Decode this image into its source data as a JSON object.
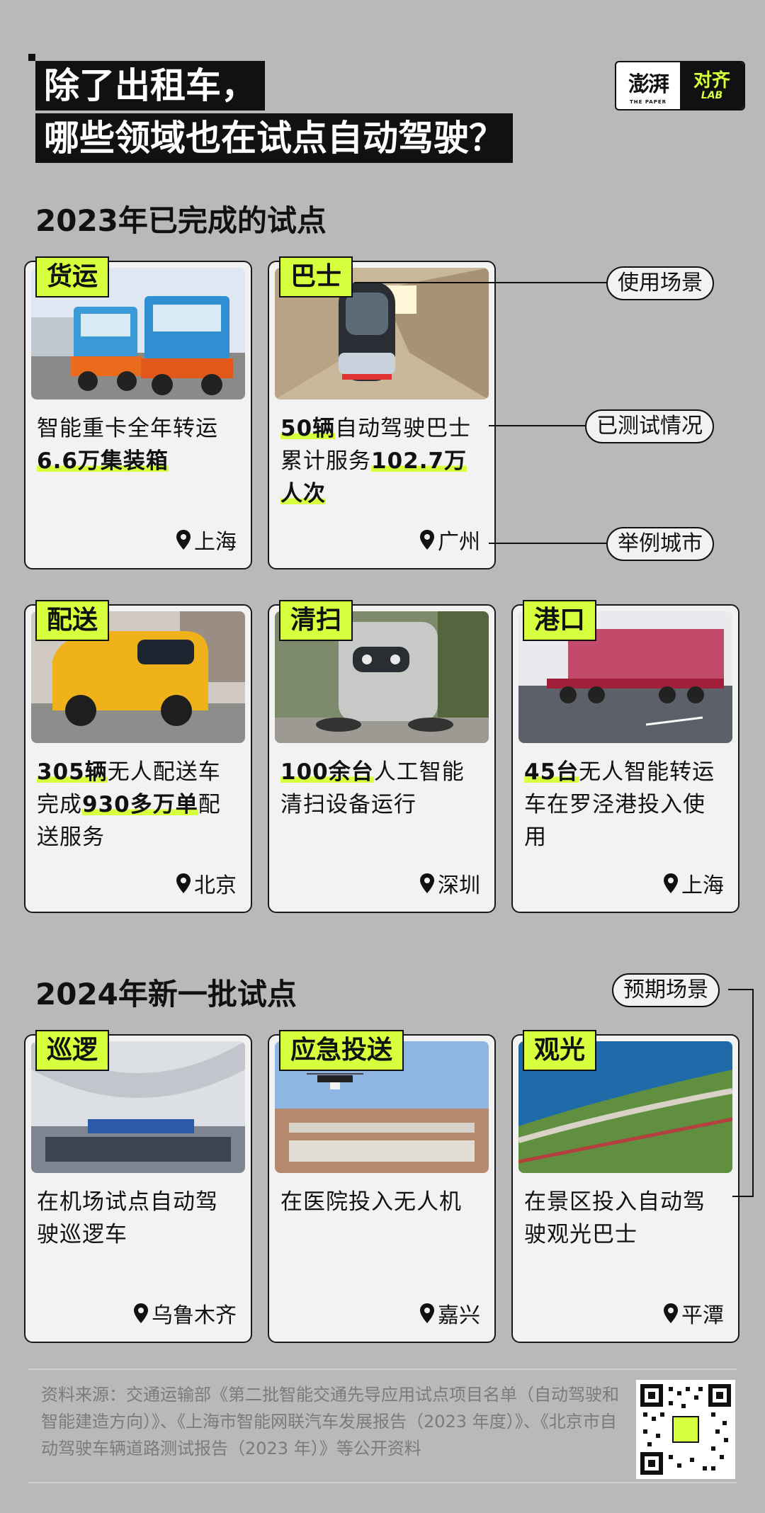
{
  "title": {
    "line1": "除了出租车，",
    "line2": "哪些领域也在试点自动驾驶？"
  },
  "logo": {
    "brand": "澎湃",
    "brand_sub": "THE PAPER",
    "lab_name": "对齐",
    "lab_tag": "LAB"
  },
  "section_2023": "2023年已完成的试点",
  "section_2024": "2024年新一批试点",
  "callouts": {
    "scene": "使用场景",
    "tested": "已测试情况",
    "city": "举例城市",
    "expected": "预期场景"
  },
  "cards": [
    {
      "tag": "货运",
      "bold1": "",
      "text1": "智能重卡全年转运",
      "bold2": "6.6万集装箱",
      "text2": "",
      "city": "上海"
    },
    {
      "tag": "巴士",
      "bold1": "50辆",
      "text1": "自动驾驶巴士累计服务",
      "bold2": "102.7万人次",
      "text2": "",
      "city": "广州"
    },
    {
      "tag": "配送",
      "bold1": "305辆",
      "text1": "无人配送车完成",
      "bold2": "930多万单",
      "text2": "配送服务",
      "city": "北京"
    },
    {
      "tag": "清扫",
      "bold1": "100余台",
      "text1": "人工智能清扫设备运行",
      "bold2": "",
      "text2": "",
      "city": "深圳"
    },
    {
      "tag": "港口",
      "bold1": "45台",
      "text1": "无人智能转运车在罗泾港投入使用",
      "bold2": "",
      "text2": "",
      "city": "上海"
    },
    {
      "tag": "巡逻",
      "bold1": "",
      "text1": "在机场试点自动驾驶巡逻车",
      "bold2": "",
      "text2": "",
      "city": "乌鲁木齐"
    },
    {
      "tag": "应急投送",
      "bold1": "",
      "text1": "在医院投入无人机",
      "bold2": "",
      "text2": "",
      "city": "嘉兴"
    },
    {
      "tag": "观光",
      "bold1": "",
      "text1": "在景区投入自动驾驶观光巴士",
      "bold2": "",
      "text2": "",
      "city": "平潭"
    }
  ],
  "source": "资料来源：交通运输部《第二批智能交通先导应用试点项目名单（自动驾驶和智能建造方向）》、《上海市智能网联汽车发展报告（2023 年度）》、《北京市自动驾驶车辆道路测试报告（2023 年）》等公开资料",
  "colors": {
    "accent": "#d6ff3d",
    "background": "#b9b9bc",
    "card": "#f2f2f2",
    "ink": "#111111"
  },
  "icons": {
    "city_marker": "location-pin-icon",
    "qr": "qr-code"
  }
}
